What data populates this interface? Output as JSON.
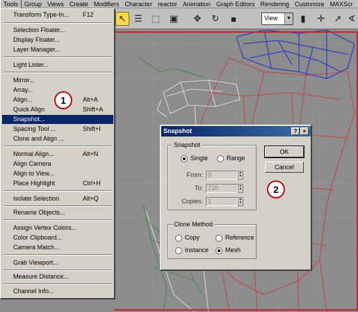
{
  "menubar": {
    "items": [
      "Tools",
      "Group",
      "Views",
      "Create",
      "Modifiers",
      "Character",
      "reactor",
      "Animation",
      "Graph Editors",
      "Rendering",
      "Customize",
      "MAXScr"
    ]
  },
  "toolbar": {
    "view_select": "View"
  },
  "tools_menu": {
    "items": [
      {
        "label": "Transform Type-In...",
        "shortcut": "F12"
      },
      {
        "label": "Selection Floater...",
        "shortcut": ""
      },
      {
        "label": "Display Floater...",
        "shortcut": ""
      },
      {
        "label": "Layer Manager...",
        "shortcut": ""
      },
      {
        "label": "Light Lister...",
        "shortcut": ""
      },
      {
        "label": "Mirror...",
        "shortcut": ""
      },
      {
        "label": "Array...",
        "shortcut": ""
      },
      {
        "label": "Align...",
        "shortcut": "Alt+A"
      },
      {
        "label": "Quick Align",
        "shortcut": "Shift+A"
      },
      {
        "label": "Snapshot...",
        "shortcut": ""
      },
      {
        "label": "Spacing Tool ...",
        "shortcut": "Shift+I"
      },
      {
        "label": "Clone and Align ...",
        "shortcut": ""
      },
      {
        "label": "Normal Align...",
        "shortcut": "Alt+N"
      },
      {
        "label": "Align Camera",
        "shortcut": ""
      },
      {
        "label": "Align to View...",
        "shortcut": ""
      },
      {
        "label": "Place Highlight",
        "shortcut": "Ctrl+H"
      },
      {
        "label": "Isolate Selection",
        "shortcut": "Alt+Q"
      },
      {
        "label": "Rename Objects...",
        "shortcut": ""
      },
      {
        "label": "Assign Vertex Colors...",
        "shortcut": ""
      },
      {
        "label": "Color Clipboard...",
        "shortcut": ""
      },
      {
        "label": "Camera Match...",
        "shortcut": ""
      },
      {
        "label": "Grab Viewport...",
        "shortcut": ""
      },
      {
        "label": "Measure Distance...",
        "shortcut": ""
      },
      {
        "label": "Channel Info...",
        "shortcut": ""
      }
    ]
  },
  "callouts": [
    "1",
    "2"
  ],
  "dialog": {
    "title": "Snapshot",
    "help": "?",
    "close": "×",
    "snapshot_group": "Snapshot",
    "single": "Single",
    "range": "Range",
    "from_label": "From:",
    "from_value": "0",
    "to_label": "To:",
    "to_value": "720",
    "copies_label": "Copies:",
    "copies_value": "1",
    "ok": "OK",
    "cancel": "Cancel",
    "clone_group": "Clone Method",
    "copy": "Copy",
    "reference": "Reference",
    "instance": "Instance",
    "mesh": "Mesh"
  },
  "colors": {
    "highlight": "#0a246a",
    "callout_border": "#b01010",
    "viewport_border": "#c0262a"
  }
}
